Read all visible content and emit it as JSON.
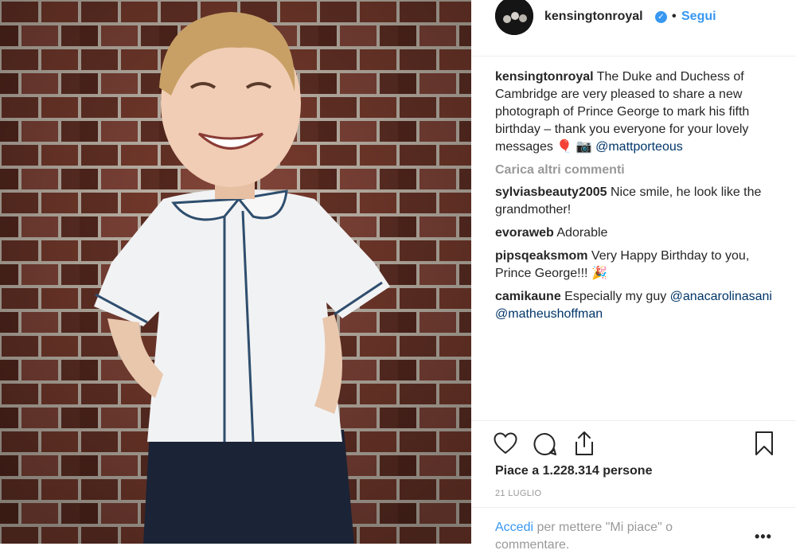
{
  "post": {
    "photo_alt": "Prince George photo",
    "author": "kensingtonroyal",
    "follow_label": "Segui",
    "dot": "•"
  },
  "caption": {
    "username": "kensingtonroyal",
    "text": " The Duke and Duchess of Cambridge are very pleased to share a new photograph of Prince George to mark his fifth birthday – thank you everyone for your lovely messages 🎈 📷 ",
    "mention": "@mattporteous"
  },
  "load_more": "Carica altri commenti",
  "comments": [
    {
      "username": "sylviasbeauty2005",
      "text": " Nice smile, he look like the grandmother!"
    },
    {
      "username": "evoraweb",
      "text": " Adorable"
    },
    {
      "username": "pipsqeaksmom",
      "text": " Very Happy Birthday to you, Prince George!!! 🎉"
    },
    {
      "username": "camikaune",
      "text": " Especially my guy ",
      "mentions": "@anacarolinasani @matheushoffman"
    }
  ],
  "likes_text": "Piace a 1.228.314 persone",
  "date": "21 LUGLIO",
  "login": {
    "link": "Accedi",
    "text": " per mettere \"Mi piace\" o commentare.",
    "options": "•••"
  },
  "colors": {
    "accent": "#3897f0",
    "mention": "#003569",
    "muted": "#999999"
  },
  "icons": [
    "heart-icon",
    "comment-icon",
    "share-icon",
    "bookmark-icon",
    "verified-icon",
    "more-options-icon"
  ]
}
